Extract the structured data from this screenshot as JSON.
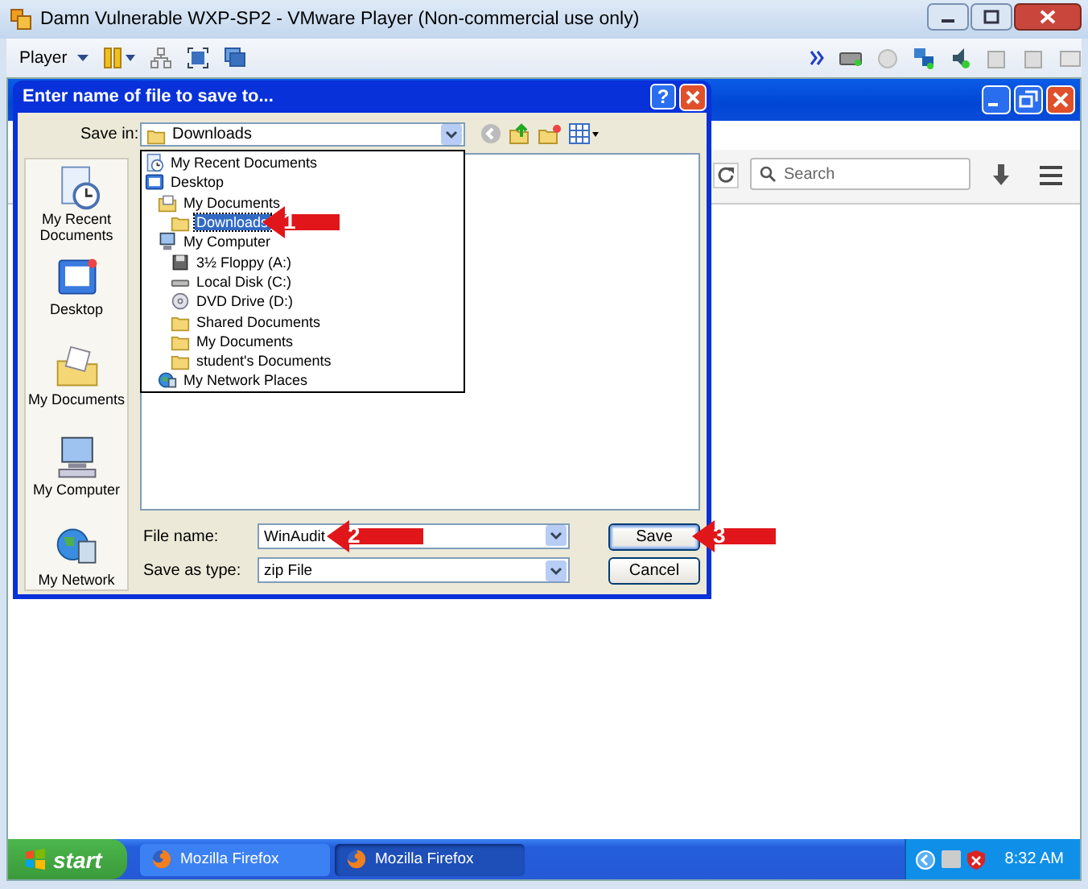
{
  "vmware": {
    "title": "Damn Vulnerable WXP-SP2 - VMware Player (Non-commercial use only)",
    "menu": "Player"
  },
  "firefox": {
    "search": {
      "placeholder": "Search"
    }
  },
  "dialog": {
    "title": "Enter name of file to save to...",
    "help": "?",
    "save_in_label": "Save in:",
    "save_in_value": "Downloads",
    "places": [
      {
        "label": "My Recent Documents",
        "kind": "recent"
      },
      {
        "label": "Desktop",
        "kind": "desktop"
      },
      {
        "label": "My Documents",
        "kind": "documents"
      },
      {
        "label": "My Computer",
        "kind": "computer"
      },
      {
        "label": "My Network",
        "kind": "network"
      }
    ],
    "locations": [
      {
        "label": "My Recent Documents",
        "kind": "recent",
        "selected": false
      },
      {
        "label": "Desktop",
        "kind": "desktop",
        "selected": false,
        "children": [
          {
            "label": "My Documents",
            "kind": "documents",
            "selected": false,
            "children": [
              {
                "label": "Downloads",
                "kind": "folder",
                "selected": true
              }
            ]
          },
          {
            "label": "My Computer",
            "kind": "computer",
            "selected": false,
            "children": [
              {
                "label": "3½ Floppy (A:)",
                "kind": "floppy",
                "selected": false
              },
              {
                "label": "Local Disk (C:)",
                "kind": "disk",
                "selected": false
              },
              {
                "label": "DVD Drive (D:)",
                "kind": "dvd",
                "selected": false
              },
              {
                "label": "Shared Documents",
                "kind": "folder",
                "selected": false
              },
              {
                "label": "My Documents",
                "kind": "folder",
                "selected": false
              },
              {
                "label": "student's Documents",
                "kind": "folder",
                "selected": false
              }
            ]
          },
          {
            "label": "My Network Places",
            "kind": "network",
            "selected": false
          }
        ]
      }
    ],
    "file_name_label": "File name:",
    "file_name": "WinAudit",
    "type_label": "Save as type:",
    "type_value": "zip File",
    "buttons": [
      {
        "label": "Save",
        "default": true
      },
      {
        "label": "Cancel",
        "default": false
      }
    ]
  },
  "callouts": [
    {
      "number": "1"
    },
    {
      "number": "2"
    },
    {
      "number": "3"
    }
  ],
  "taskbar": {
    "start": "start",
    "tasks": [
      {
        "label": "Mozilla Firefox",
        "selected": false
      },
      {
        "label": "Mozilla Firefox",
        "selected": true
      }
    ],
    "clock": "8:32 AM"
  }
}
